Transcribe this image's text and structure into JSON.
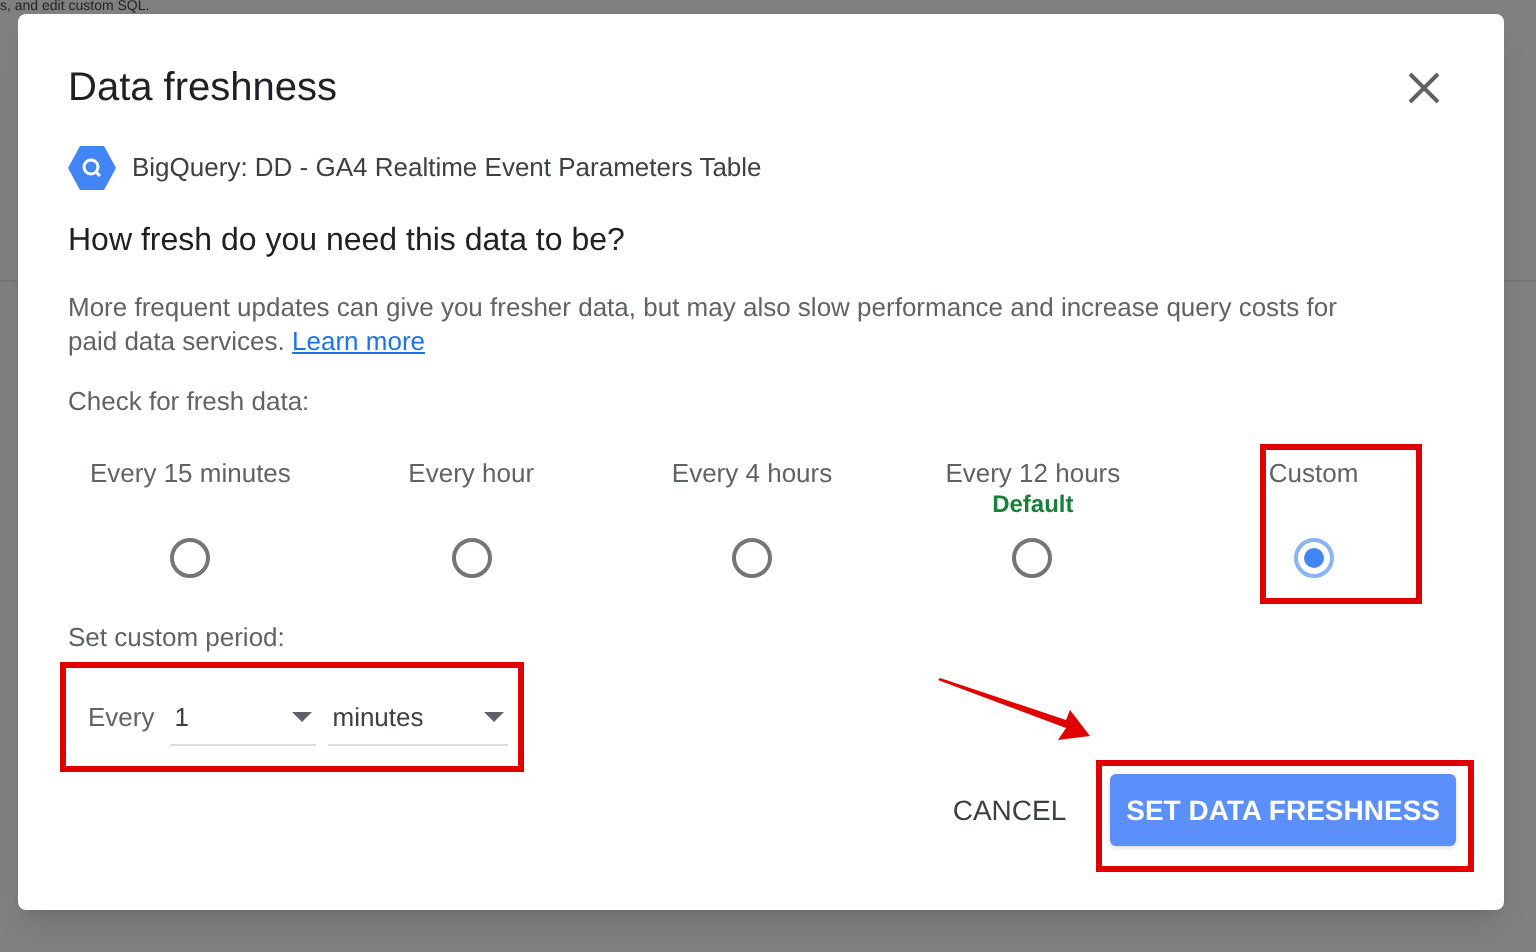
{
  "background": {
    "text": "s, and edit custom SQL."
  },
  "dialog": {
    "title": "Data freshness",
    "source": "BigQuery: DD - GA4 Realtime Event Parameters Table",
    "question": "How fresh do you need this data to be?",
    "description": "More frequent updates can give you fresher data, but may also slow performance and increase query costs for paid data services.",
    "learn_more": "Learn more",
    "check_label": "Check for fresh data:",
    "options": [
      {
        "label": "Every 15 minutes",
        "selected": false
      },
      {
        "label": "Every hour",
        "selected": false
      },
      {
        "label": "Every 4 hours",
        "selected": false
      },
      {
        "label": "Every 12 hours",
        "note": "Default",
        "selected": false
      },
      {
        "label": "Custom",
        "selected": true
      }
    ],
    "custom_label": "Set custom period:",
    "every": "Every",
    "amount": "1",
    "unit": "minutes",
    "buttons": {
      "cancel": "CANCEL",
      "confirm": "SET DATA FRESHNESS"
    }
  }
}
